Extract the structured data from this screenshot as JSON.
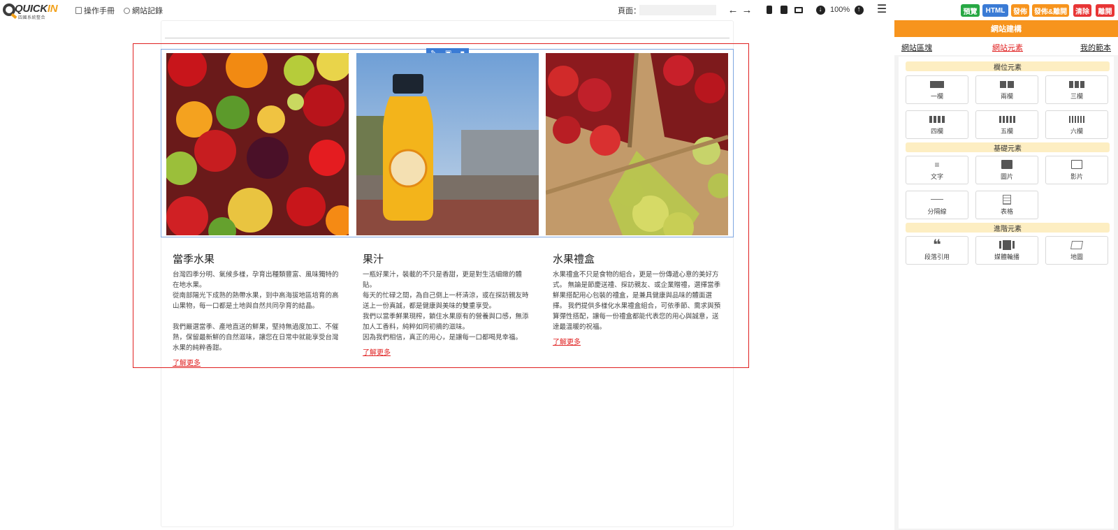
{
  "topbar": {
    "logo_word_a": "QUICK",
    "logo_word_b": "IN",
    "logo_sub": "四國系統整合",
    "manual_label": "操作手冊",
    "history_label": "網站記錄",
    "page_label": "頁面：",
    "page_value": "",
    "zoom": "100%",
    "buttons": {
      "preview": "預覽",
      "html": "HTML",
      "publish": "發佈",
      "publish_leave": "發佈&離開",
      "clear": "清除",
      "leave": "離開"
    },
    "colors": {
      "preview": "#27a844",
      "html": "#3a7bd5",
      "publish": "#f7941d",
      "publish_leave": "#f7941d",
      "clear": "#e83535",
      "leave": "#e83535"
    }
  },
  "columns": [
    {
      "title": "當季水果",
      "text": "台灣四季分明、氣候多樣，孕育出種類豐富、風味獨特的在地水果。\n從南部陽光下成熟的熱帶水果，到中高海拔地區培育的高山果物，每一口都是土地與自然共同孕育的結晶。\n\n我們嚴選當季、產地直送的鮮果，堅持無過度加工、不催熟，保留最新鮮的自然滋味，讓您在日常中就能享受台灣水果的純粹香甜。",
      "link": "了解更多"
    },
    {
      "title": "果汁",
      "text": "一瓶好果汁，裝載的不只是香甜，更是對生活細緻的體貼。\n每天的忙碌之間，為自己倒上一杯清涼，或在探訪親友時送上一份真誠，都是健康與美味的雙重享受。\n我們以當季鮮果現榨，鎖住水果原有的營養與口感，無添加人工香料，純粹如同初摘的滋味。\n因為我們相信，真正的用心，是讓每一口都喝見幸福。",
      "link": "了解更多"
    },
    {
      "title": "水果禮盒",
      "text": "水果禮盒不只是食物的組合，更是一份傳遞心意的美好方式。 無論是節慶送禮、探訪親友、或企業贈禮，選擇當季鮮果搭配用心包裝的禮盒，是兼具健康與品味的體面選擇。 我們提供多樣化水果禮盒組合，可依季節、需求與預算彈性搭配，讓每一份禮盒都能代表您的用心與誠意，送達最溫暖的祝福。",
      "link": "了解更多"
    }
  ],
  "panel": {
    "header": "網站建構",
    "tabs": [
      "網站區塊",
      "網站元素",
      "我的範本"
    ],
    "active_tab": "網站元素",
    "sections": [
      {
        "title": "欄位元素",
        "items": [
          "一欄",
          "兩欄",
          "三欄",
          "四欄",
          "五欄",
          "六欄"
        ]
      },
      {
        "title": "基礎元素",
        "items": [
          "文字",
          "圖片",
          "影片",
          "分隔線",
          "表格"
        ]
      },
      {
        "title": "進階元素",
        "items": [
          "段落引用",
          "媒體輪播",
          "地圖"
        ]
      }
    ]
  },
  "icons": {
    "edit": "pencil-icon",
    "image": "image-icon",
    "delete": "trash-icon",
    "undo": "arrow-left-icon",
    "redo": "arrow-right-icon",
    "mobile": "mobile-icon",
    "tablet": "tablet-icon",
    "desktop": "desktop-icon",
    "zoom_out": "zoom-out-icon",
    "zoom_in": "zoom-in-icon",
    "menu": "hamburger-icon"
  }
}
